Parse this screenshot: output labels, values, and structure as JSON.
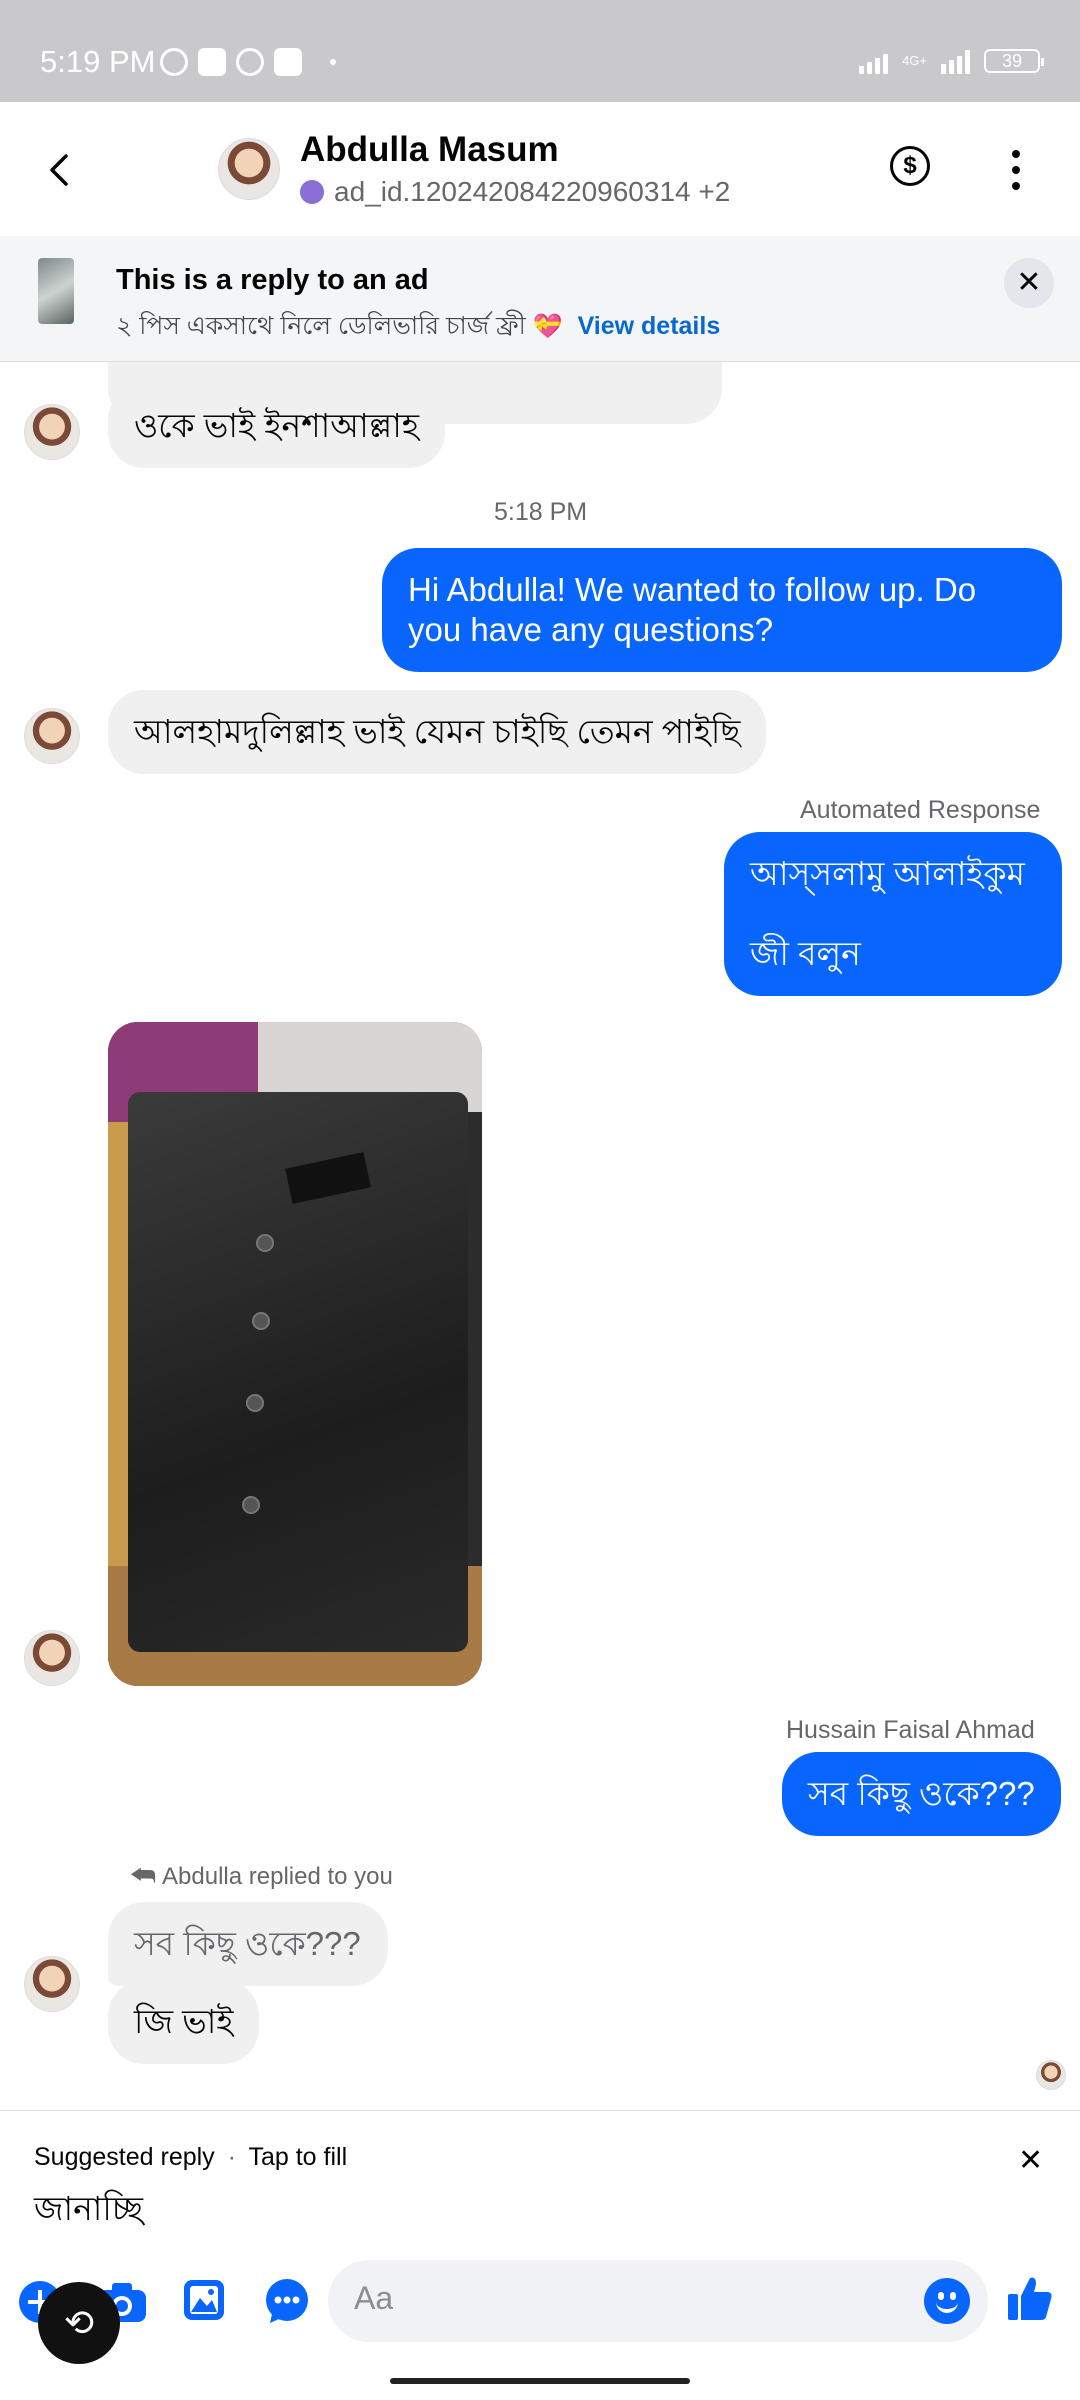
{
  "status_bar": {
    "time": "5:19 PM",
    "network": "4G+",
    "battery": "39"
  },
  "header": {
    "contact_name": "Abdulla Masum",
    "contact_sub": "ad_id.120242084220960314 +2",
    "icons": [
      "back-icon",
      "dollar-icon",
      "more-icon"
    ]
  },
  "ad_banner": {
    "title": "This is a reply to an ad",
    "text": "২ পিস একসাথে নিলে ডেলিভারি চার্জ ফ্রী",
    "emoji": "💝",
    "link": "View details"
  },
  "messages": {
    "m1": "ওকে ভাই ইনশাআল্লাহ",
    "time_sep": "5:18 PM",
    "m2": "Hi Abdulla! We wanted to follow up. Do you have any questions?",
    "m3": "আলহামদুলিল্লাহ ভাই যেমন চাইছি তেমন পাইছি",
    "auto_label": "Automated Response",
    "m4_line1": "আস্সলামু আলাইকুম",
    "m4_line2": "জী বলুন",
    "sender_label": "Hussain Faisal Ahmad",
    "m5": "সব কিছু ওকে???",
    "reply_note": "Abdulla replied to you",
    "quoted": "সব কিছু ওকে???",
    "m6": "জি ভাই"
  },
  "suggested_reply": {
    "label": "Suggested reply",
    "hint": "Tap to fill",
    "text": "জানাচ্ছি"
  },
  "composer": {
    "placeholder": "Aa",
    "icons": [
      "plus-icon",
      "camera-icon",
      "gallery-icon",
      "chat-icon",
      "emoji-icon",
      "like-icon"
    ]
  },
  "colors": {
    "outgoing_bubble": "#0866ff",
    "incoming_bubble": "#f0f0f0",
    "accent": "#0866ff"
  }
}
